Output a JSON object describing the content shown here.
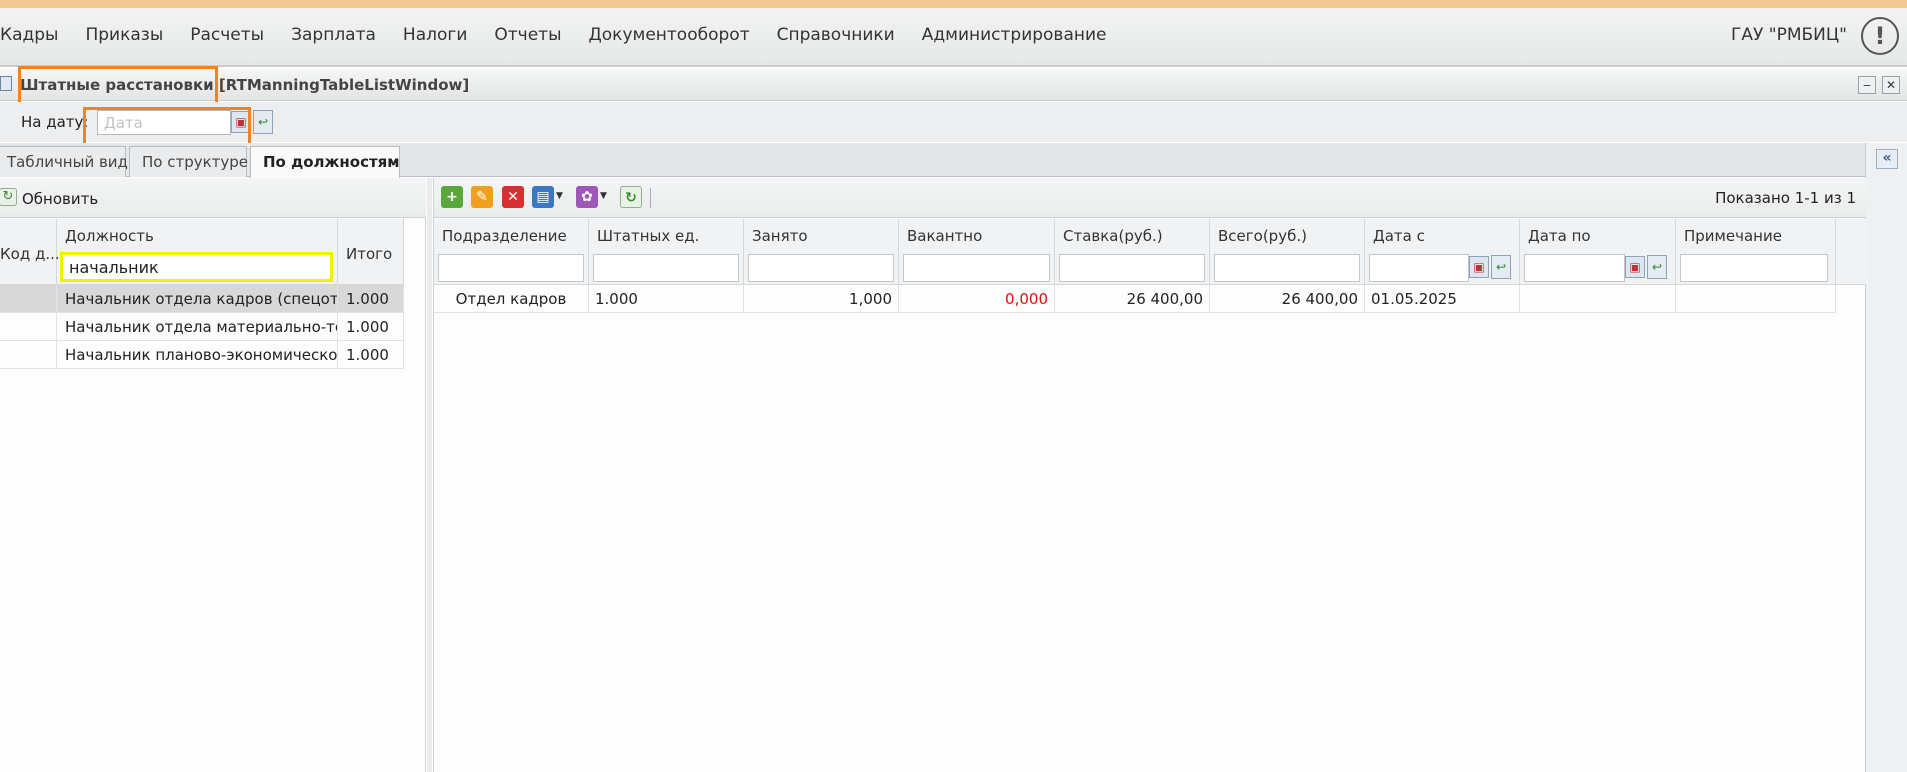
{
  "menu": {
    "items": [
      "Кадры",
      "Приказы",
      "Расчеты",
      "Зарплата",
      "Налоги",
      "Отчеты",
      "Документооборот",
      "Справочники",
      "Администрирование"
    ],
    "org": "ГАУ \"РМБИЦ\"",
    "alert_icon": "!"
  },
  "window": {
    "title": "Штатные расстановки [RTManningTableListWindow]",
    "minimize": "‒",
    "close": "✕"
  },
  "datefilter": {
    "label": "На дату:",
    "placeholder": "Дата"
  },
  "tabs": [
    "Табличный вид",
    "По структуре",
    "По должностям"
  ],
  "active_tab": "По должностям",
  "left": {
    "refresh_label": "Обновить",
    "columns": [
      "Код д...",
      "Должность",
      "Итого"
    ],
    "filter_value": "начальник",
    "rows": [
      {
        "name": "Начальник отдела кадров (спецотде...",
        "total": "1.000",
        "selected": true
      },
      {
        "name": "Начальник отдела материально-тех...",
        "total": "1.000",
        "selected": false
      },
      {
        "name": "Начальник планово-экономического...",
        "total": "1.000",
        "selected": false
      }
    ]
  },
  "right": {
    "paging": "Показано 1-1 из 1",
    "columns": [
      "Подразделение",
      "Штатных ед.",
      "Занято",
      "Вакантно",
      "Ставка(руб.)",
      "Всего(руб.)",
      "Дата с",
      "Дата по",
      "Примечание"
    ],
    "rows": [
      {
        "dept": "Отдел кадров",
        "units": "1.000",
        "occupied": "1,000",
        "vacant": "0,000",
        "rate": "26 400,00",
        "total": "26 400,00",
        "date_from": "01.05.2025",
        "date_to": "",
        "note": ""
      }
    ]
  },
  "colors": {
    "highlight": "#f58220",
    "vacant_zero": "#e01010",
    "filter_focus": "#f0f000"
  }
}
